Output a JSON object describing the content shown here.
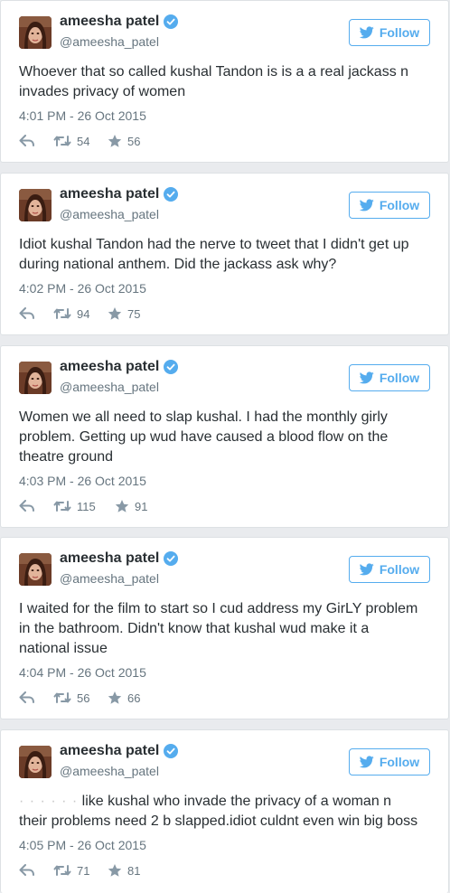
{
  "user": {
    "name": "ameesha patel",
    "handle": "@ameesha_patel",
    "follow_label": "Follow",
    "verified_icon": "verified-badge-icon"
  },
  "colors": {
    "accent": "#55acee",
    "text": "#292f33",
    "muted": "#66757f",
    "background": "#e9ebee"
  },
  "tweets": [
    {
      "text": "Whoever that so called kushal Tandon is is a a real jackass n invades privacy of women",
      "timestamp": "4:01 PM - 26 Oct 2015",
      "retweets": "54",
      "likes": "56"
    },
    {
      "text": "Idiot kushal Tandon had the nerve to tweet that I didn't get up during national anthem. Did the jackass ask why?",
      "timestamp": "4:02 PM - 26 Oct 2015",
      "retweets": "94",
      "likes": "75"
    },
    {
      "text": "Women we all need to slap kushal. I had the monthly girly problem. Getting up wud have caused a blood flow on the theatre ground",
      "timestamp": "4:03 PM - 26 Oct 2015",
      "retweets": "115",
      "likes": "91"
    },
    {
      "text": "I waited for the film to start so I cud address my GirLY problem in the bathroom. Didn't know that kushal wud make it a national issue",
      "timestamp": "4:04 PM - 26 Oct 2015",
      "retweets": "56",
      "likes": "66"
    },
    {
      "text_faded": "· · · · · ·",
      "text": "like kushal who invade the privacy of a woman n their problems need 2 b slapped.idiot culdnt even win big boss",
      "timestamp": "4:05 PM - 26 Oct 2015",
      "retweets": "71",
      "likes": "81"
    }
  ]
}
